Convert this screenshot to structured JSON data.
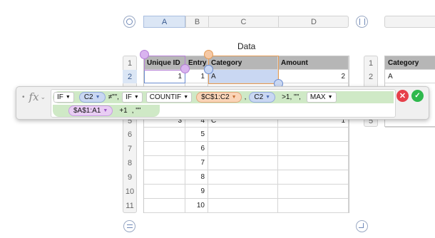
{
  "table_data": {
    "title": "Data",
    "columns": [
      "A",
      "B",
      "C",
      "D"
    ],
    "selected_column": "A",
    "headers": [
      "Unique ID",
      "Entry",
      "Category",
      "Amount"
    ],
    "rows": [
      {
        "num": "1",
        "a": "",
        "b": "",
        "c": "",
        "d": ""
      },
      {
        "num": "2",
        "a": "1",
        "b": "1",
        "c": "A",
        "d": "2"
      },
      {
        "num": "5",
        "a": "3",
        "b": "4",
        "c": "C",
        "d": "1"
      },
      {
        "num": "6",
        "a": "",
        "b": "5",
        "c": "",
        "d": ""
      },
      {
        "num": "7",
        "a": "",
        "b": "6",
        "c": "",
        "d": ""
      },
      {
        "num": "8",
        "a": "",
        "b": "7",
        "c": "",
        "d": ""
      },
      {
        "num": "9",
        "a": "",
        "b": "8",
        "c": "",
        "d": ""
      },
      {
        "num": "10",
        "a": "",
        "b": "9",
        "c": "",
        "d": ""
      },
      {
        "num": "11",
        "a": "",
        "b": "10",
        "c": "",
        "d": ""
      }
    ]
  },
  "side_table": {
    "header": "Category",
    "rows": [
      {
        "num": "1",
        "value": "Category"
      },
      {
        "num": "2",
        "value": "A"
      },
      {
        "num": "5",
        "value": ""
      }
    ]
  },
  "formula": {
    "fx_label": "fx",
    "if1": "IF",
    "ref_c2": "C2",
    "neq_text": "≠\"\",",
    "if2": "IF",
    "countif": "COUNTIF",
    "ref_range": "$C$1:C2",
    "comma": ",",
    "ref_c2_b": "C2",
    "gt_text": ">1,  \"\",",
    "max": "MAX",
    "ref_a": "$A$1:A1",
    "plus_one": "+1",
    "tail": ", \"\""
  },
  "icons": {
    "cancel": "✕",
    "accept": "✓",
    "caret": "▼"
  },
  "colors": {
    "accent_blue": "#6b8cd0",
    "accent_orange": "#e39a56",
    "accent_purple": "#b57fd6",
    "cancel_red": "#e6404a",
    "accept_green": "#2fb84d"
  }
}
